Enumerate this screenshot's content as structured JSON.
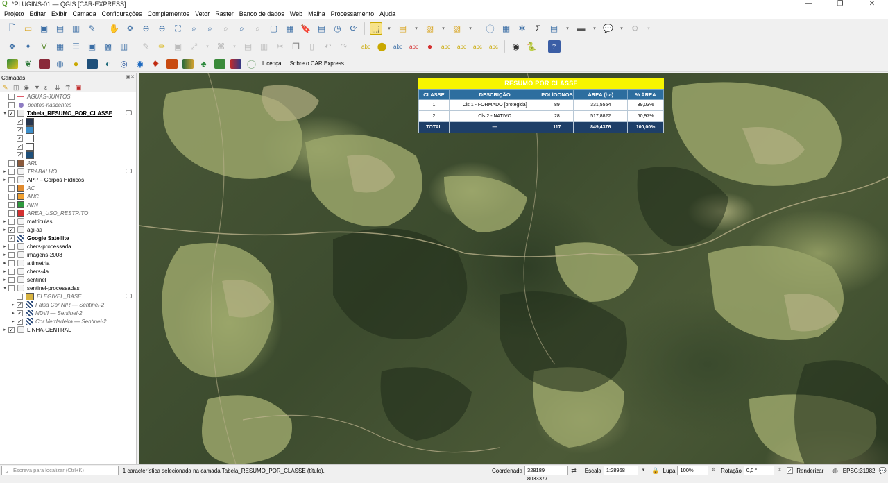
{
  "window": {
    "title": "*PLUGINS-01 — QGIS [CAR-EXPRESS]"
  },
  "menu": [
    "Projeto",
    "Editar",
    "Exibir",
    "Camada",
    "Configurações",
    "Complementos",
    "Vetor",
    "Raster",
    "Banco de dados",
    "Web",
    "Malha",
    "Processamento",
    "Ajuda"
  ],
  "plugin_toolbar": {
    "license_label": "Licença",
    "about_label": "Sobre o CAR Express"
  },
  "layers_panel": {
    "title": "Camadas",
    "layers": [
      {
        "name": "AGUAS-JUNTOS",
        "style": "it",
        "checked": false,
        "expand": "",
        "symbol": "line",
        "color": "#e05a6a"
      },
      {
        "name": "pontos-nascentes",
        "style": "it",
        "checked": false,
        "expand": "",
        "symbol": "dot",
        "color": "#8e7cc3"
      },
      {
        "name": "Tabela_RESUMO_POR_CLASSE",
        "style": "u",
        "checked": true,
        "expand": "▾",
        "symbol": "table",
        "color": "#999999",
        "eye": true
      },
      {
        "name": "",
        "style": "",
        "checked": true,
        "expand": "",
        "indent": 1,
        "symbol": "fill",
        "color": "#27364f"
      },
      {
        "name": "",
        "style": "",
        "checked": true,
        "expand": "",
        "indent": 1,
        "symbol": "fill",
        "color": "#3d8ec9"
      },
      {
        "name": "",
        "style": "",
        "checked": true,
        "expand": "",
        "indent": 1,
        "symbol": "fill",
        "color": "#ffffff"
      },
      {
        "name": "",
        "style": "",
        "checked": true,
        "expand": "",
        "indent": 1,
        "symbol": "fill",
        "color": "#ffffff"
      },
      {
        "name": "",
        "style": "",
        "checked": true,
        "expand": "",
        "indent": 1,
        "symbol": "fill",
        "color": "#1e4f7a"
      },
      {
        "name": "ARL",
        "style": "it",
        "checked": false,
        "expand": "",
        "symbol": "fill",
        "color": "#8b5a3c"
      },
      {
        "name": "TRABALHO",
        "style": "it",
        "checked": false,
        "expand": "▸",
        "symbol": "group",
        "color": "#999999",
        "eye": true
      },
      {
        "name": "APP – Corpos Hídricos",
        "style": "",
        "checked": false,
        "expand": "▸",
        "symbol": "group",
        "color": "#999999"
      },
      {
        "name": "AC",
        "style": "it",
        "checked": false,
        "expand": "",
        "symbol": "fill",
        "color": "#e08a2e"
      },
      {
        "name": "ANC",
        "style": "it",
        "checked": false,
        "expand": "",
        "symbol": "fill",
        "color": "#f0a030"
      },
      {
        "name": "AVN",
        "style": "it",
        "checked": false,
        "expand": "",
        "symbol": "fill",
        "color": "#2e9a3e"
      },
      {
        "name": "AREA_USO_RESTRITO",
        "style": "it",
        "checked": false,
        "expand": "",
        "symbol": "fill",
        "color": "#d43030"
      },
      {
        "name": "matriculas",
        "style": "",
        "checked": false,
        "expand": "▸",
        "symbol": "group",
        "color": "#999999"
      },
      {
        "name": "agi-ati",
        "style": "",
        "checked": true,
        "expand": "▸",
        "symbol": "group",
        "color": "#999999"
      },
      {
        "name": "Google Satellite",
        "style": "b",
        "checked": true,
        "expand": "",
        "symbol": "raster",
        "color": "#2a4a7a"
      },
      {
        "name": "cbers-processada",
        "style": "",
        "checked": false,
        "expand": "▸",
        "symbol": "group",
        "color": "#999999"
      },
      {
        "name": "imagens-2008",
        "style": "",
        "checked": false,
        "expand": "▸",
        "symbol": "group",
        "color": "#999999"
      },
      {
        "name": "altimetria",
        "style": "",
        "checked": false,
        "expand": "▸",
        "symbol": "group",
        "color": "#999999"
      },
      {
        "name": "cbers-4a",
        "style": "",
        "checked": false,
        "expand": "▸",
        "symbol": "group",
        "color": "#999999"
      },
      {
        "name": "sentinel",
        "style": "",
        "checked": false,
        "expand": "▸",
        "symbol": "group",
        "color": "#999999"
      },
      {
        "name": "sentinel-processadas",
        "style": "",
        "checked": false,
        "expand": "▾",
        "symbol": "group",
        "color": "#999999"
      },
      {
        "name": "ELEGIVEL_BASE",
        "style": "it",
        "checked": false,
        "expand": "",
        "indent": 1,
        "symbol": "fill",
        "color": "#d8b340",
        "eye": true
      },
      {
        "name": "Falsa Cor NIR — Sentinel-2",
        "style": "it",
        "checked": true,
        "expand": "▸",
        "indent": 1,
        "symbol": "raster",
        "color": "#2a4a7a"
      },
      {
        "name": "NDVI — Sentinel-2",
        "style": "it",
        "checked": true,
        "expand": "▸",
        "indent": 1,
        "symbol": "raster",
        "color": "#2a4a7a"
      },
      {
        "name": "Cor Verdadeira — Sentinel-2",
        "style": "it",
        "checked": true,
        "expand": "▸",
        "indent": 1,
        "symbol": "raster",
        "color": "#2a4a7a"
      },
      {
        "name": "LINHA-CENTRAL",
        "style": "",
        "checked": true,
        "expand": "▸",
        "symbol": "group",
        "color": "#999999"
      }
    ]
  },
  "resumo": {
    "title": "RESUMO POR CLASSE",
    "headers": [
      "CLASSE",
      "DESCRIÇÃO",
      "POLÍGONOS",
      "ÁREA (ha)",
      "% ÁREA"
    ],
    "rows": [
      [
        "1",
        "Cls 1 - FORMADO [protegida]",
        "89",
        "331,5554",
        "39,03%"
      ],
      [
        "2",
        "Cls 2 - NATIVO",
        "28",
        "517,8822",
        "60,97%"
      ]
    ],
    "total": [
      "TOTAL",
      "—",
      "117",
      "849,4376",
      "100,00%"
    ]
  },
  "status": {
    "search_placeholder": "Escreva para localizar (Ctrl+K)",
    "message": "1 característica selecionada na camada Tabela_RESUMO_POR_CLASSE (título).",
    "coord_label": "Coordenada",
    "coord_value": "328189  8033377",
    "scale_label": "Escala",
    "scale_value": "1:28968",
    "lupa_label": "Lupa",
    "lupa_value": "100%",
    "rotation_label": "Rotação",
    "rotation_value": "0,0 °",
    "render_label": "Renderizar",
    "epsg": "EPSG:31982"
  }
}
